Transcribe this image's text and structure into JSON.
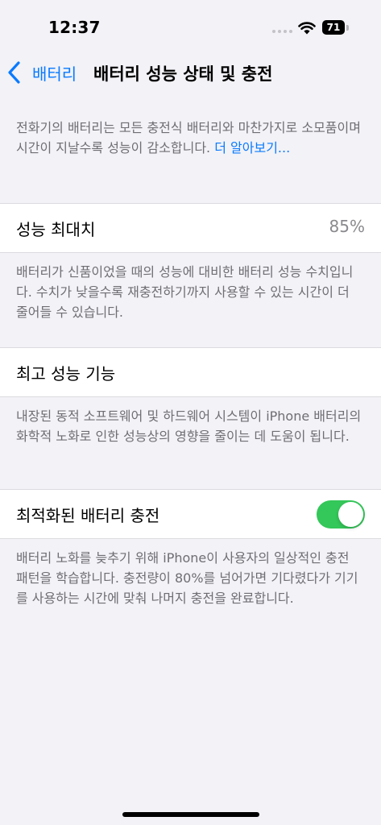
{
  "status_bar": {
    "time": "12:37",
    "battery_level": "71"
  },
  "nav": {
    "back_label": "배터리",
    "title": "배터리 성능 상태 및 충전"
  },
  "intro": {
    "text": "전화기의 배터리는 모든 충전식 배터리와 마찬가지로 소모품이며 시간이 지날수록 성능이 감소합니다. ",
    "link": "더 알아보기..."
  },
  "max_capacity": {
    "label": "성능 최대치",
    "value": "85%",
    "footnote": "배터리가 신품이었을 때의 성능에 대비한 배터리 성능 수치입니다. 수치가 낮을수록 재충전하기까지 사용할 수 있는 시간이 더 줄어들 수 있습니다."
  },
  "peak_performance": {
    "label": "최고 성능 기능",
    "footnote": "내장된 동적 소프트웨어 및 하드웨어 시스템이 iPhone 배터리의 화학적 노화로 인한 성능상의 영향을 줄이는 데 도움이 됩니다."
  },
  "optimized_charging": {
    "label": "최적화된 배터리 충전",
    "enabled": true,
    "footnote": "배터리 노화를 늦추기 위해 iPhone이 사용자의 일상적인 충전 패턴을 학습합니다. 충전량이 80%를 넘어가면 기다렸다가 기기를 사용하는 시간에 맞춰 나머지 충전을 완료합니다."
  },
  "colors": {
    "accent": "#0a7aff",
    "toggle_on": "#34c759",
    "background": "#f2f2f7"
  }
}
